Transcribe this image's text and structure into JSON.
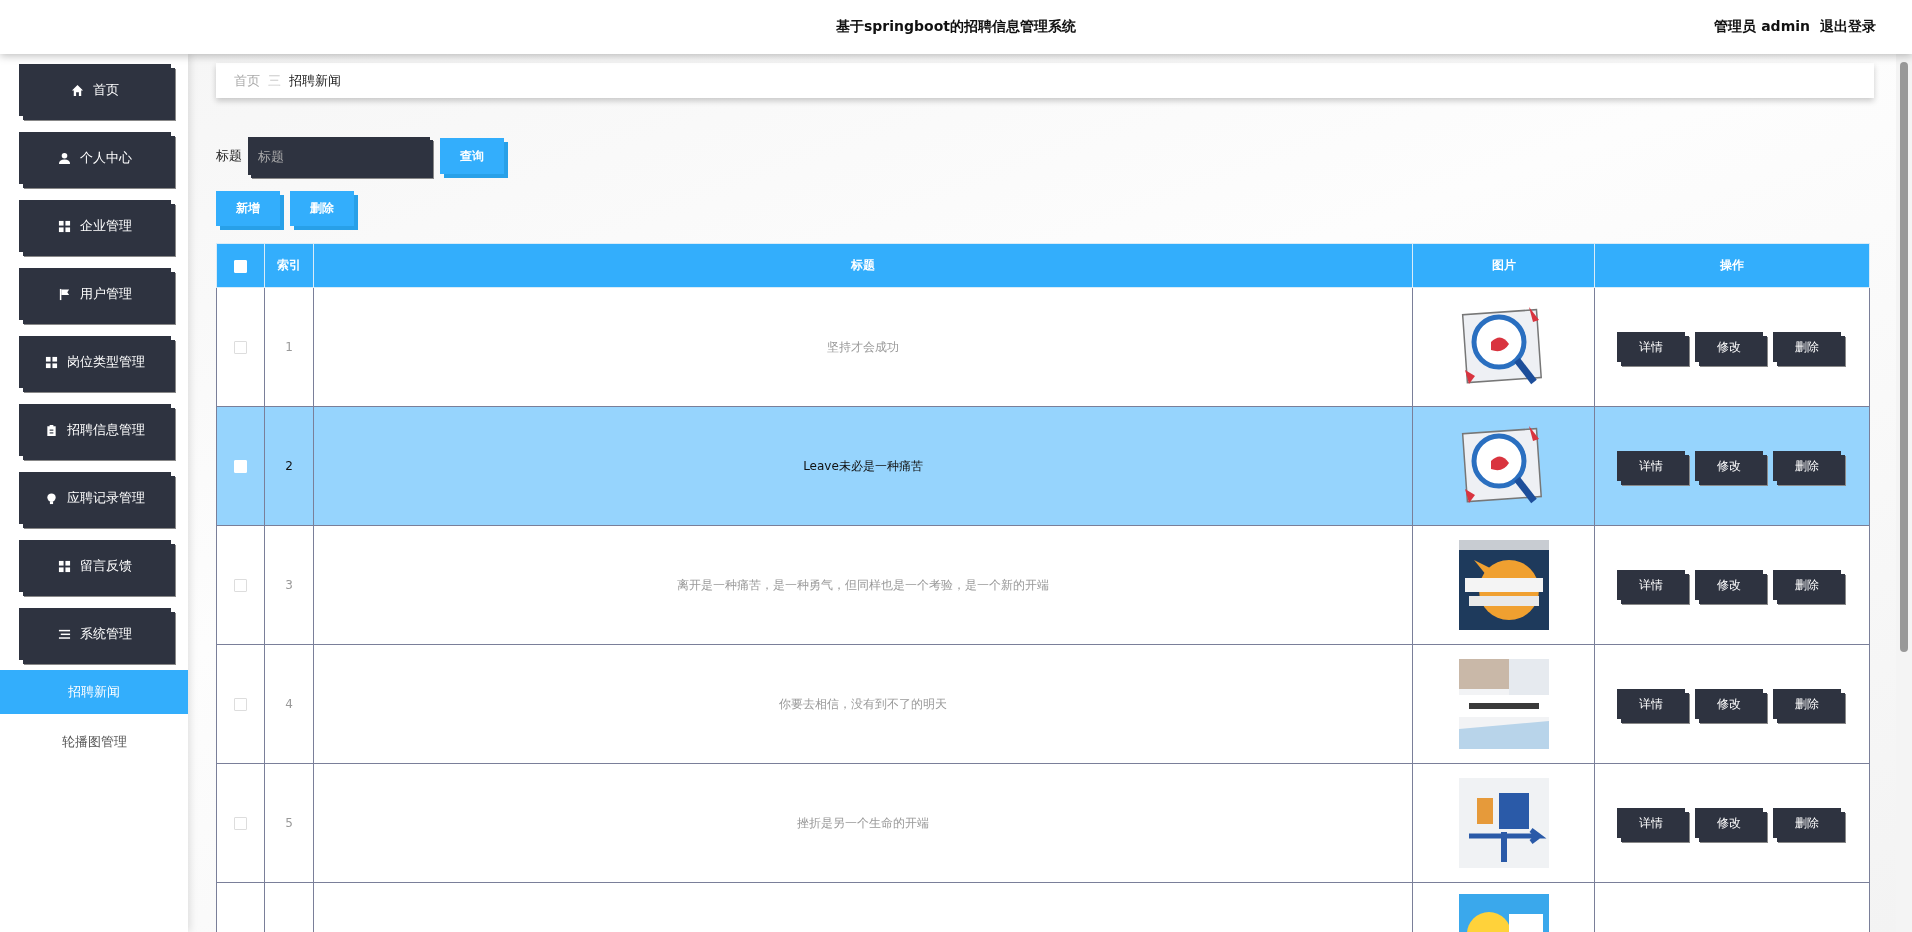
{
  "header": {
    "title": "基于springboot的招聘信息管理系统",
    "user": "管理员 admin",
    "logout": "退出登录"
  },
  "sidebar": {
    "items": [
      {
        "label": "首页",
        "selected": false
      },
      {
        "label": "个人中心",
        "selected": false
      },
      {
        "label": "企业管理",
        "selected": false
      },
      {
        "label": "用户管理",
        "selected": false
      },
      {
        "label": "岗位类型管理",
        "selected": false
      },
      {
        "label": "招聘信息管理",
        "selected": false
      },
      {
        "label": "应聘记录管理",
        "selected": false
      },
      {
        "label": "留言反馈",
        "selected": false
      },
      {
        "label": "系统管理",
        "selected": false,
        "children": [
          {
            "label": "招聘新闻",
            "selected": true
          },
          {
            "label": "轮播图管理",
            "selected": false
          }
        ]
      }
    ]
  },
  "breadcrumb": {
    "home": "首页",
    "separator": "三",
    "current": "招聘新闻"
  },
  "search": {
    "label": "标题",
    "placeholder": "标题",
    "button": "查询"
  },
  "toolbar": [
    "新增",
    "删除"
  ],
  "table": {
    "header_checked": false,
    "columns": [
      "索引",
      "标题",
      "图片",
      "操作"
    ],
    "rows": [
      {
        "checked": false,
        "selected": false,
        "index": "1",
        "title": "坚持才会成功",
        "actions": [
          "详情",
          "修改",
          "删除"
        ]
      },
      {
        "checked": false,
        "selected": true,
        "index": "2",
        "title": "Leave未必是一种痛苦",
        "actions": [
          "详情",
          "修改",
          "删除"
        ]
      },
      {
        "checked": false,
        "selected": false,
        "index": "3",
        "title": "离开是一种痛苦，是一种勇气，但同样也是一个考验，是一个新的开端",
        "actions": [
          "详情",
          "修改",
          "删除"
        ]
      },
      {
        "checked": false,
        "selected": false,
        "index": "4",
        "title": "你要去相信，没有到不了的明天",
        "actions": [
          "详情",
          "修改",
          "删除"
        ]
      },
      {
        "checked": false,
        "selected": false,
        "index": "5",
        "title": "挫折是另一个生命的开端",
        "actions": [
          "详情",
          "修改",
          "删除"
        ]
      },
      {
        "selected": false
      }
    ]
  }
}
